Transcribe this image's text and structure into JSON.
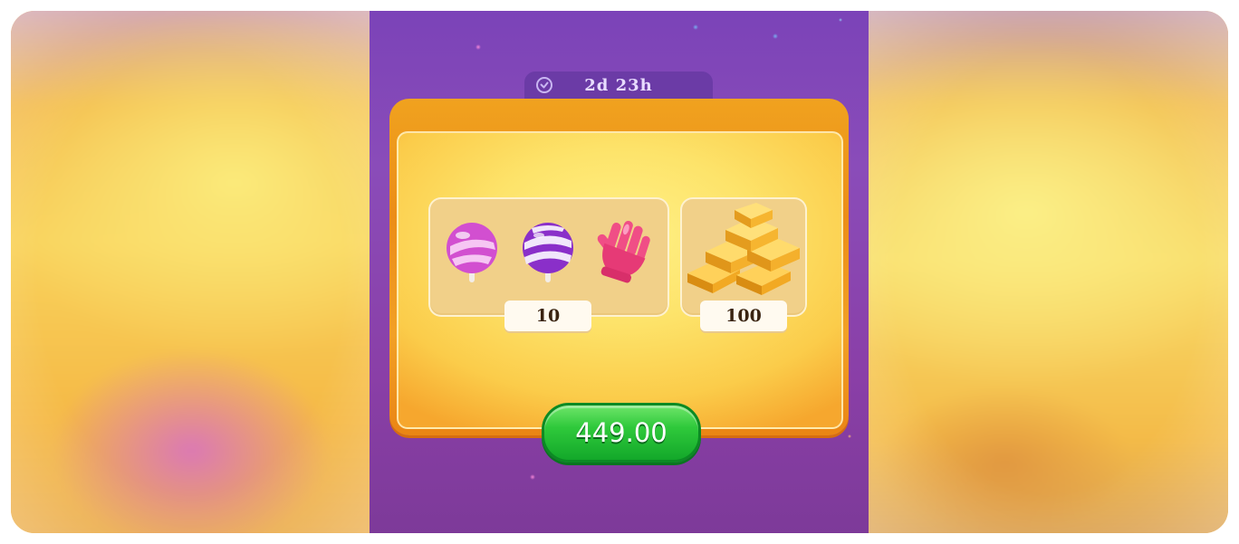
{
  "offer": {
    "timer_text": "2d 23h",
    "boosters_count": "10",
    "gold_count": "100",
    "price_label": "449.00"
  },
  "items": {
    "boosters": [
      "pink-lollipop-hammer-icon",
      "striped-lollipop-icon",
      "pink-glove-icon"
    ],
    "gold": "gold-bars-icon"
  },
  "colors": {
    "background_purple": "#8a4cb9",
    "panel_orange": "#ee8f18",
    "inner_yellow": "#fde36a",
    "price_green": "#2fc93b"
  }
}
